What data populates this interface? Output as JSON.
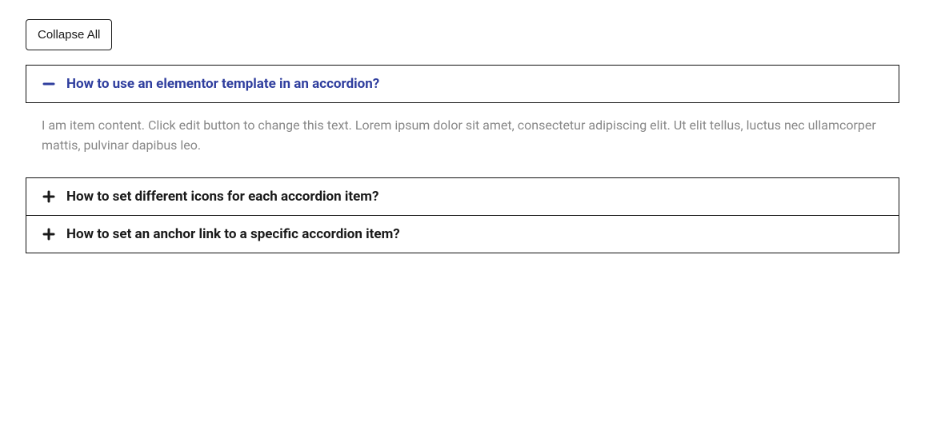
{
  "controls": {
    "collapse_all_label": "Collapse All"
  },
  "accordion": {
    "items": [
      {
        "title": "How to use an elementor template in an accordion?",
        "expanded": true,
        "content": "I am item content. Click edit button to change this text. Lorem ipsum dolor sit amet, consectetur adipiscing elit. Ut elit tellus, luctus nec ullamcorper mattis, pulvinar dapibus leo."
      },
      {
        "title": "How to set different icons for each accordion item?",
        "expanded": false,
        "content": ""
      },
      {
        "title": "How to set an anchor link to a specific accordion item?",
        "expanded": false,
        "content": ""
      }
    ]
  },
  "colors": {
    "active": "#2f3e9e",
    "text": "#1a1a1a",
    "muted": "#888888",
    "border": "#111111"
  }
}
